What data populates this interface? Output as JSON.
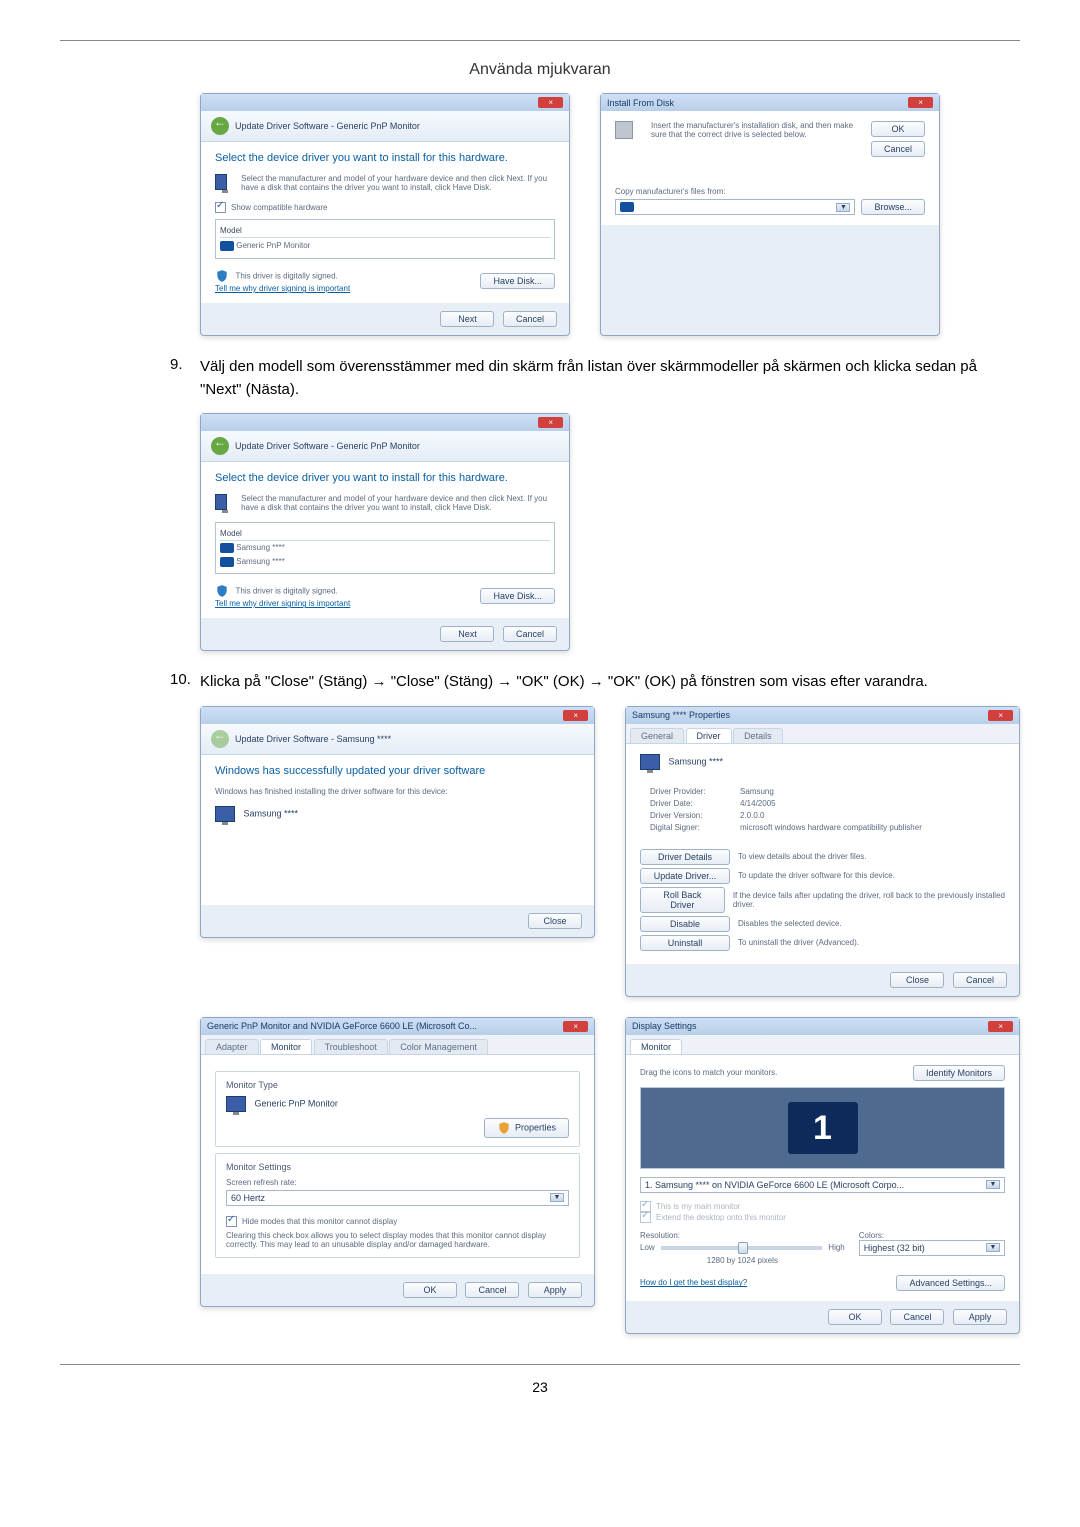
{
  "header": {
    "title": "Använda mjukvaran"
  },
  "steps": {
    "s9": {
      "num": "9.",
      "text": "Välj den modell som överensstämmer med din skärm från listan över skärmmodeller på skärmen och klicka sedan på \"Next\" (Nästa)."
    },
    "s10": {
      "num": "10.",
      "text": "Klicka på \"Close\" (Stäng) → \"Close\" (Stäng) → \"OK\" (OK) → \"OK\" (OK) på fönstren som visas efter varandra."
    }
  },
  "dlg1": {
    "breadcrumb": "Update Driver Software - Generic PnP Monitor",
    "heading": "Select the device driver you want to install for this hardware.",
    "desc": "Select the manufacturer and model of your hardware device and then click Next. If you have a disk that contains the driver you want to install, click Have Disk.",
    "show_compat": "Show compatible hardware",
    "model_col": "Model",
    "model_item": "Generic PnP Monitor",
    "signed": "This driver is digitally signed.",
    "signed_link": "Tell me why driver signing is important",
    "have_disk": "Have Disk...",
    "next": "Next",
    "cancel": "Cancel"
  },
  "dlg2": {
    "title": "Install From Disk",
    "text": "Insert the manufacturer's installation disk, and then make sure that the correct drive is selected below.",
    "ok": "OK",
    "cancel": "Cancel",
    "copyfrom": "Copy manufacturer's files from:",
    "browse": "Browse..."
  },
  "dlg3": {
    "breadcrumb": "Update Driver Software - Generic PnP Monitor",
    "heading": "Select the device driver you want to install for this hardware.",
    "desc": "Select the manufacturer and model of your hardware device and then click Next. If you have a disk that contains the driver you want to install, click Have Disk.",
    "model_col": "Model",
    "item1": "Samsung ****",
    "item2": "Samsung ****",
    "signed": "This driver is digitally signed.",
    "signed_link": "Tell me why driver signing is important",
    "have_disk": "Have Disk...",
    "next": "Next",
    "cancel": "Cancel"
  },
  "dlg4": {
    "breadcrumb": "Update Driver Software - Samsung ****",
    "heading": "Windows has successfully updated your driver software",
    "sub": "Windows has finished installing the driver software for this device:",
    "device": "Samsung ****",
    "close": "Close"
  },
  "dlg5": {
    "title": "Samsung **** Properties",
    "tabs": {
      "general": "General",
      "driver": "Driver",
      "details": "Details"
    },
    "device": "Samsung ****",
    "provider_l": "Driver Provider:",
    "provider_v": "Samsung",
    "date_l": "Driver Date:",
    "date_v": "4/14/2005",
    "version_l": "Driver Version:",
    "version_v": "2.0.0.0",
    "signer_l": "Digital Signer:",
    "signer_v": "microsoft windows hardware compatibility publisher",
    "btn_details": "Driver Details",
    "btn_details_t": "To view details about the driver files.",
    "btn_update": "Update Driver...",
    "btn_update_t": "To update the driver software for this device.",
    "btn_rollback": "Roll Back Driver",
    "btn_rollback_t": "If the device fails after updating the driver, roll back to the previously installed driver.",
    "btn_disable": "Disable",
    "btn_disable_t": "Disables the selected device.",
    "btn_uninstall": "Uninstall",
    "btn_uninstall_t": "To uninstall the driver (Advanced).",
    "close": "Close",
    "cancel": "Cancel"
  },
  "dlg6": {
    "title": "Generic PnP Monitor and NVIDIA GeForce 6600 LE (Microsoft Co...",
    "tabs": {
      "adapter": "Adapter",
      "monitor": "Monitor",
      "trouble": "Troubleshoot",
      "color": "Color Management"
    },
    "montype_legend": "Monitor Type",
    "montype_val": "Generic PnP Monitor",
    "properties": "Properties",
    "monset_legend": "Monitor Settings",
    "refresh_l": "Screen refresh rate:",
    "refresh_v": "60 Hertz",
    "hide_check": "Hide modes that this monitor cannot display",
    "hide_desc": "Clearing this check box allows you to select display modes that this monitor cannot display correctly. This may lead to an unusable display and/or damaged hardware.",
    "ok": "OK",
    "cancel": "Cancel",
    "apply": "Apply"
  },
  "dlg7": {
    "title": "Display Settings",
    "tab": "Monitor",
    "drag": "Drag the icons to match your monitors.",
    "identify": "Identify Monitors",
    "monitor_num": "1",
    "device": "1. Samsung **** on NVIDIA GeForce 6600 LE (Microsoft Corpo...",
    "main_chk": "This is my main monitor",
    "extend_chk": "Extend the desktop onto this monitor",
    "res_l": "Resolution:",
    "low": "Low",
    "high": "High",
    "res_val": "1280 by 1024 pixels",
    "colors_l": "Colors:",
    "colors_v": "Highest (32 bit)",
    "best_link": "How do I get the best display?",
    "adv": "Advanced Settings...",
    "ok": "OK",
    "cancel": "Cancel",
    "apply": "Apply"
  },
  "footer": {
    "page": "23"
  }
}
